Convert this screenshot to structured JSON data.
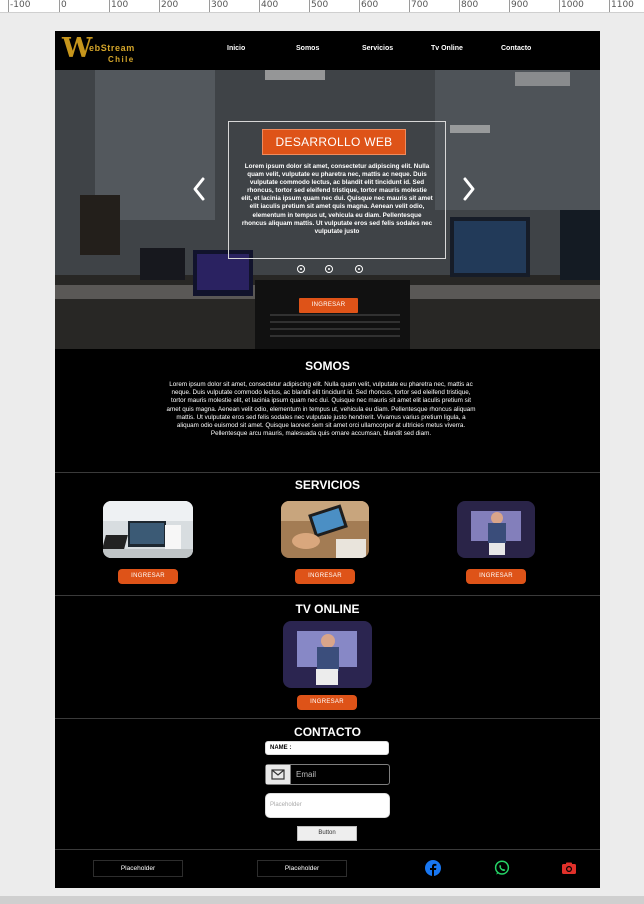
{
  "ruler": {
    "labels": [
      "-100",
      "0",
      "100",
      "200",
      "300",
      "400",
      "500",
      "600",
      "700",
      "800",
      "900",
      "1000",
      "1100"
    ]
  },
  "brand": {
    "logo_mark": "W",
    "logo_line1": "ebStream",
    "logo_line2": "Chile",
    "accent": "#de5318",
    "gold": "#c7961c"
  },
  "nav": {
    "items": [
      "Inicio",
      "Somos",
      "Servicios",
      "Tv Online",
      "Contacto"
    ]
  },
  "hero": {
    "title": "DESARROLLO WEB",
    "text": "Lorem ipsum dolor sit amet, consectetur adipiscing elit. Nulla quam velit, vulputate eu pharetra nec, mattis ac neque. Duis vulputate commodo lectus, ac blandit elit tincidunt id. Sed rhoncus, tortor sed eleifend tristique, tortor mauris molestie elit, et lacinia ipsum quam nec dui. Quisque nec mauris sit amet elit iaculis pretium sit amet quis magna. Aenean velit odio, elementum in tempus ut, vehicula eu diam. Pellentesque rhoncus aliquam mattis. Ut vulputate eros sed felis sodales nec vulputate justo",
    "button": "INGRESAR",
    "prev_icon": "chevron-left-icon",
    "next_icon": "chevron-right-icon",
    "indicators": 3
  },
  "somos": {
    "title": "SOMOS",
    "text": "Lorem ipsum dolor sit amet, consectetur adipiscing elit. Nulla quam velit, vulputate eu pharetra nec, mattis ac neque. Duis vulputate commodo lectus, ac blandit elit tincidunt id. Sed rhoncus, tortor sed eleifend tristique, tortor mauris molestie elit, et lacinia ipsum quam nec dui. Quisque nec mauris sit amet elit iaculis pretium sit amet quis magna. Aenean velit odio, elementum in tempus ut, vehicula eu diam. Pellentesque rhoncus aliquam mattis. Ut vulputate eros sed felis sodales nec vulputate justo hendrerit. Vivamus varius pretium ligula, a aliquam odio euismod sit amet. Quisque laoreet sem sit amet orci ullamcorper at ultricies metus viverra. Pellentesque arcu mauris, malesuada quis ornare accumsan, blandit sed diam."
  },
  "servicios": {
    "title": "SERVICIOS",
    "cards": [
      {
        "button": "INGRESAR"
      },
      {
        "button": "INGRESAR"
      },
      {
        "button": "INGRESAR"
      }
    ]
  },
  "tv": {
    "title": "TV ONLINE",
    "button": "INGRESAR"
  },
  "contacto": {
    "title": "CONTACTO",
    "name_label": "NAME :",
    "email_placeholder": "Email",
    "email_icon": "mail-icon",
    "field_placeholder": "Placeholder",
    "button": "Button"
  },
  "footer": {
    "field1": "Placeholder",
    "field2": "Placeholder",
    "social": [
      {
        "icon": "facebook-icon",
        "color": "#1877f2"
      },
      {
        "icon": "whatsapp-icon",
        "color": "#25d366"
      },
      {
        "icon": "camera-icon",
        "color": "#e1302a"
      }
    ]
  }
}
